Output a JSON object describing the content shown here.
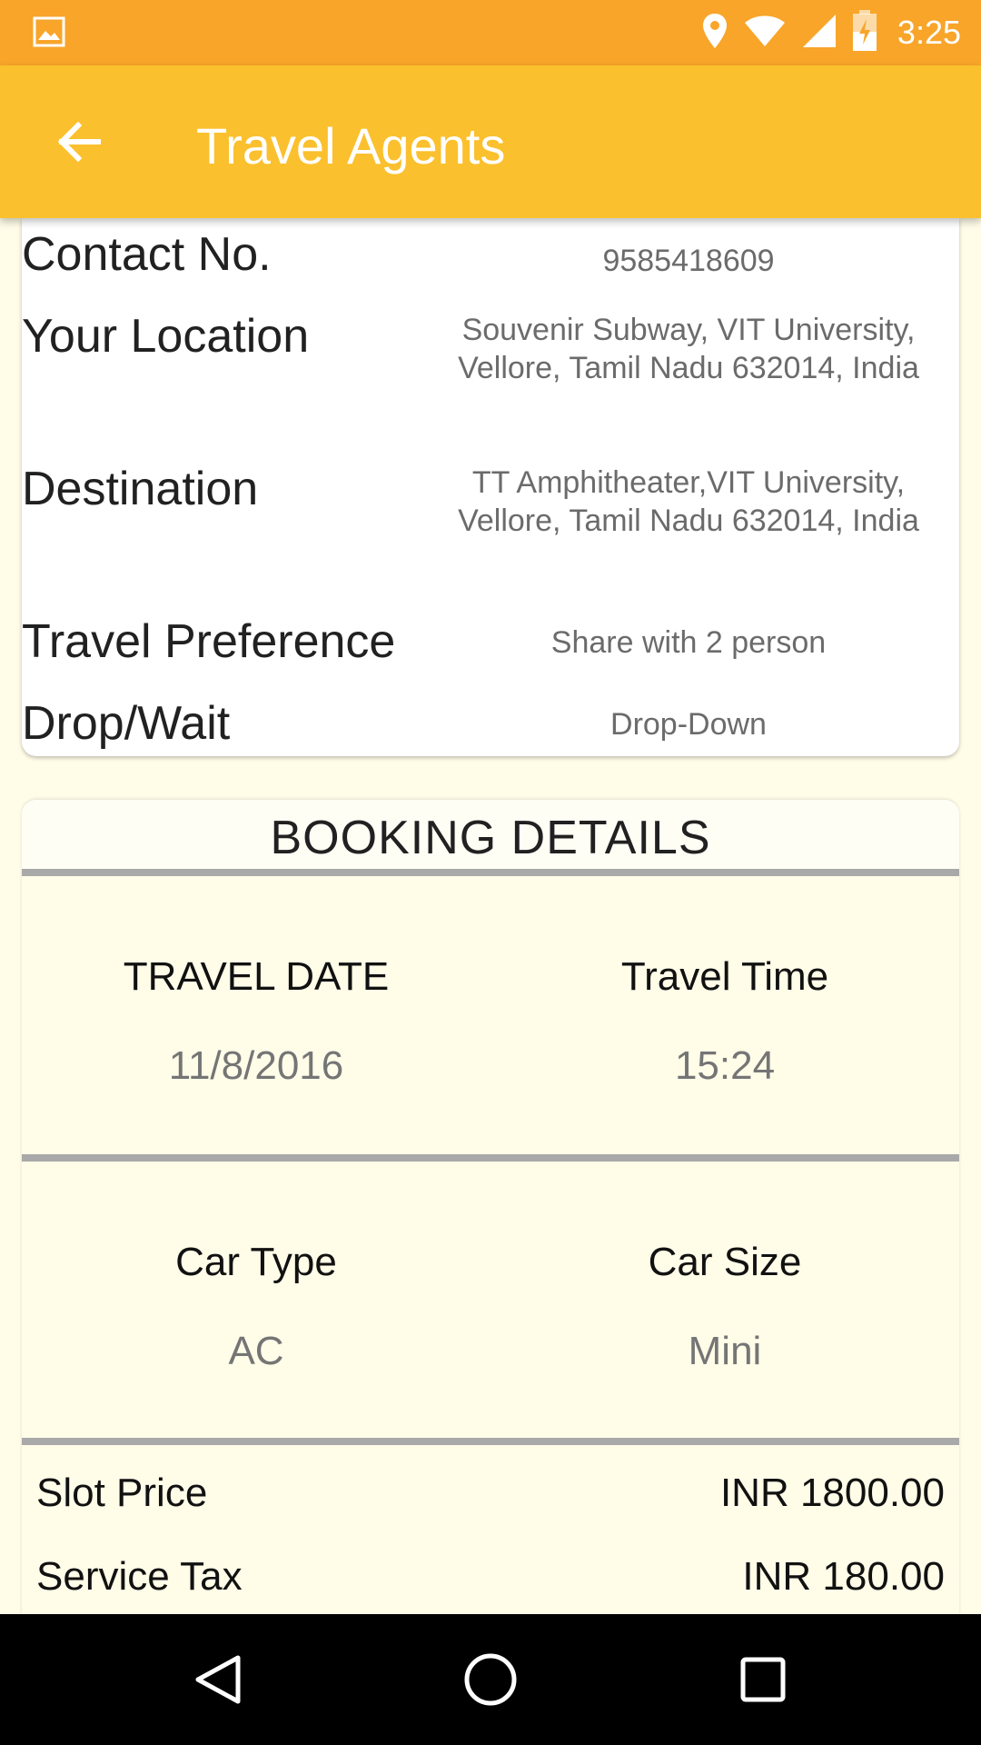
{
  "status_bar": {
    "time": "3:25"
  },
  "app_bar": {
    "title": "Travel Agents"
  },
  "details": [
    {
      "label": "Contact No.",
      "value": "9585418609"
    },
    {
      "label": "Your Location",
      "value": "Souvenir Subway, VIT University, Vellore, Tamil Nadu 632014, India"
    },
    {
      "label": "Destination",
      "value": "TT Amphitheater,VIT University, Vellore, Tamil Nadu 632014, India"
    },
    {
      "label": "Travel Preference",
      "value": "Share with 2 person"
    },
    {
      "label": "Drop/Wait",
      "value": "Drop-Down"
    }
  ],
  "booking": {
    "title": "BOOKING DETAILS",
    "travel_date_label": "TRAVEL DATE",
    "travel_date": "11/8/2016",
    "travel_time_label": "Travel Time",
    "travel_time": "15:24",
    "car_type_label": "Car Type",
    "car_type": "AC",
    "car_size_label": "Car Size",
    "car_size": "Mini",
    "slot_price_label": "Slot Price",
    "slot_price": "INR 1800.00",
    "service_tax_label": "Service Tax",
    "service_tax": "INR 180.00"
  },
  "colors": {
    "status_bar": "#f8a52a",
    "app_bar": "#fbc02d",
    "background": "#fffce8"
  },
  "icons": [
    "gallery-icon",
    "location-icon",
    "wifi-icon",
    "signal-icon",
    "battery-charging-icon",
    "back-arrow-icon",
    "nav-back-icon",
    "nav-home-icon",
    "nav-recents-icon"
  ]
}
